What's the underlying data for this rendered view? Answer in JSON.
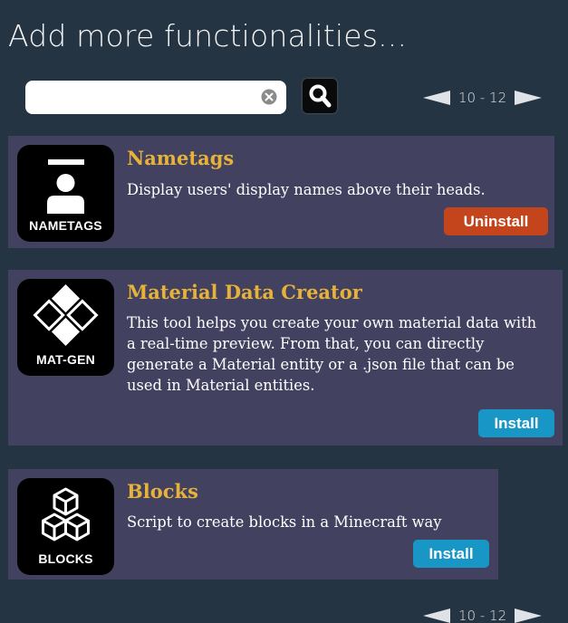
{
  "header": {
    "title": "Add more functionalities..."
  },
  "search": {
    "value": "",
    "placeholder": "",
    "clear_icon": "clear-circle-icon",
    "search_icon": "magnifier-icon"
  },
  "pager_top": {
    "range": "10 - 12"
  },
  "pager_bottom": {
    "range": "10 - 12"
  },
  "plugins": [
    {
      "icon_caption": "NAMETAGS",
      "icon": "person-nametag-icon",
      "name": "Nametags",
      "description": "Display users' display names above their heads.",
      "action": "Uninstall"
    },
    {
      "icon_caption": "MAT-GEN",
      "icon": "material-tiles-icon",
      "name": "Material Data Creator",
      "description": "This tool helps you create your own material data with a real-time preview. From that, you can directly generate a Material entity or a .json file that can be used in Material entities.",
      "action": "Install"
    },
    {
      "icon_caption": "BLOCKS",
      "icon": "cubes-icon",
      "name": "Blocks",
      "description": "Script to create blocks in a Minecraft way",
      "action": "Install"
    }
  ],
  "colors": {
    "background": "#253443",
    "card": "#42415f",
    "title_accent": "#e6b23a",
    "uninstall": "#c4451c",
    "install": "#1896c6"
  }
}
